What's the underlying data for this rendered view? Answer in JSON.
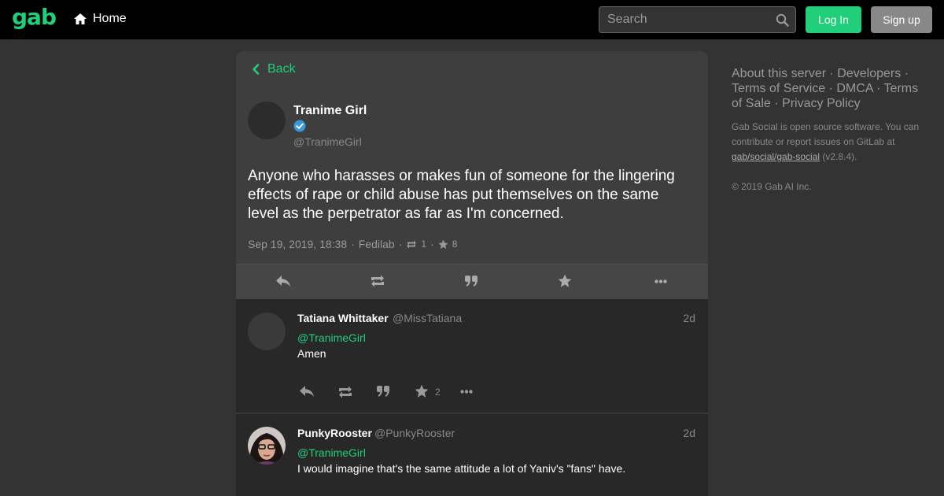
{
  "topbar": {
    "logo": "gab",
    "home_label": "Home",
    "search_placeholder": "Search",
    "login_label": "Log In",
    "signup_label": "Sign up"
  },
  "detail": {
    "back_label": "Back",
    "author_name": "Tranime Girl",
    "author_handle": "@TranimeGirl",
    "text": "Anyone who harasses or makes fun of someone for the lingering effects of rape or child abuse has put themselves on the same level as the perpetrator as far as I'm concerned.",
    "timestamp": "Sep 19, 2019, 18:38",
    "app": "Fedilab",
    "sep": "·",
    "reposts": "1",
    "favourites": "8"
  },
  "replies": [
    {
      "name": "Tatiana Whittaker",
      "handle": "@MissTatiana",
      "time": "2d",
      "mention": "@TranimeGirl",
      "text": "Amen",
      "favourites": "2"
    },
    {
      "name": "PunkyRooster",
      "handle": "@PunkyRooster",
      "time": "2d",
      "mention": "@TranimeGirl",
      "text": "I would imagine that's the same attitude a lot of Yaniv's \"fans\" have."
    }
  ],
  "sidebar": {
    "links": [
      "About this server",
      "Developers",
      "Terms of Service",
      "DMCA",
      "Terms of Sale",
      "Privacy Policy"
    ],
    "sep": "·",
    "about_pre": "Gab Social is open source software. You can contribute or report issues on GitLab at",
    "repo_link": "gab/social/gab-social",
    "version": "(v2.8.4).",
    "copyright": "© 2019 Gab AI Inc."
  },
  "colors": {
    "accent": "#21cf7a",
    "background": "#333333",
    "topbar": "#000000",
    "card": "#3e3e3e",
    "reply_bg": "#282828",
    "verified": "#3a9ad9"
  },
  "icons": [
    "home-icon",
    "search-icon",
    "chevron-left-icon",
    "verified-check-icon",
    "reply-icon",
    "repost-icon",
    "quote-icon",
    "star-icon",
    "more-icon"
  ]
}
